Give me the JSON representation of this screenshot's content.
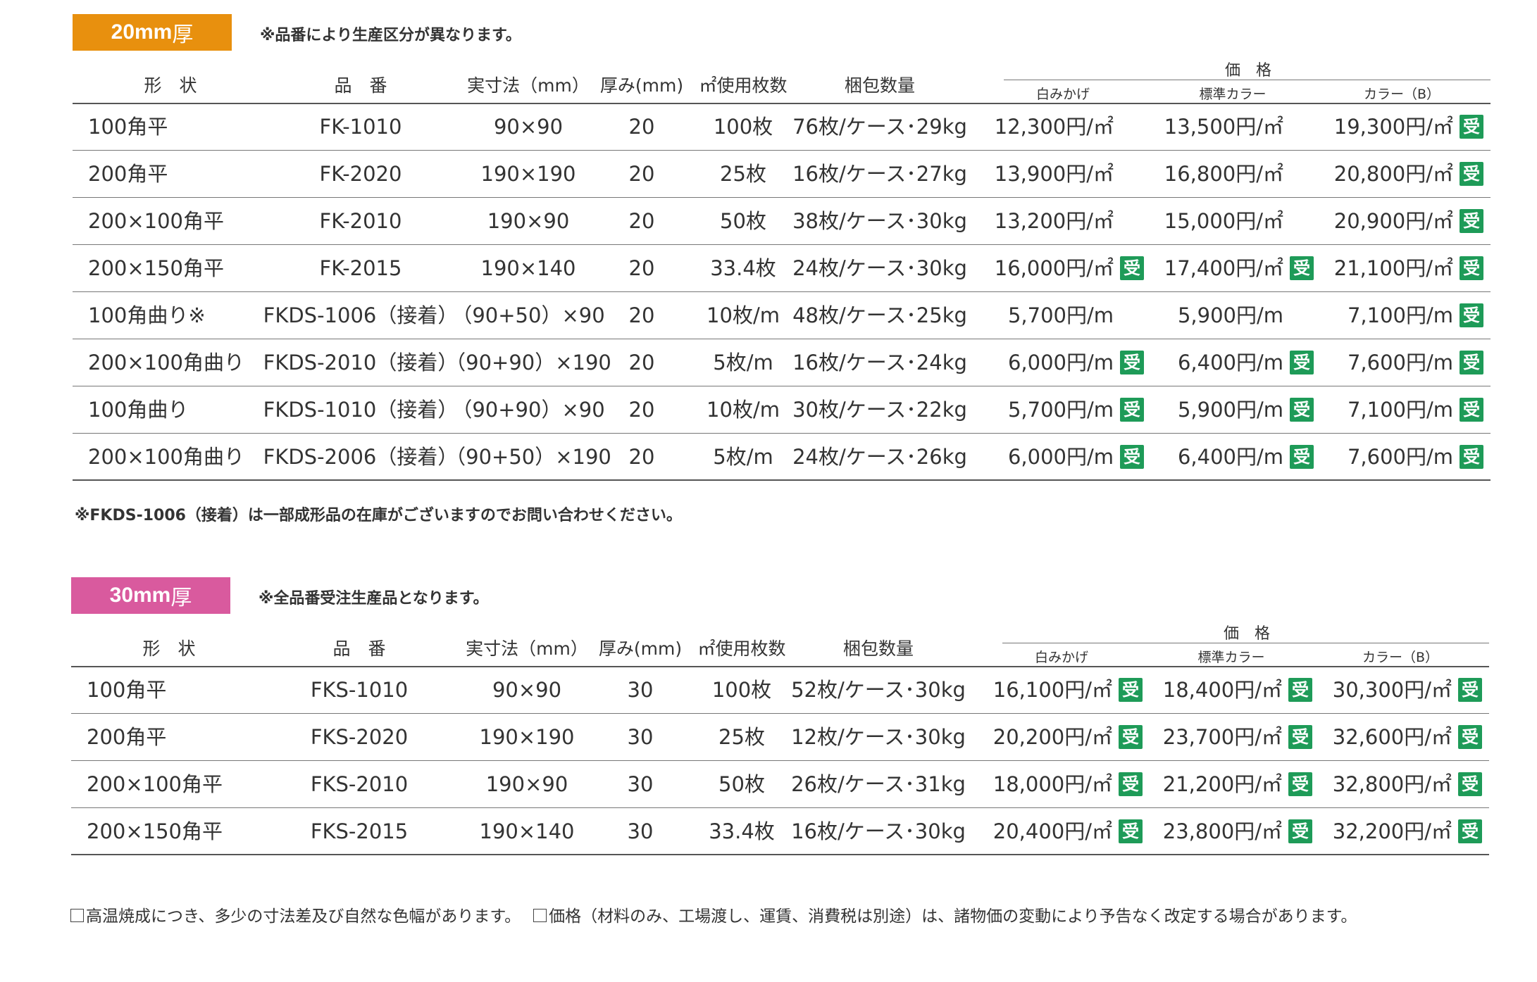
{
  "colors": {
    "orange": "#e8900e",
    "pink": "#d95a9e",
    "uke_green": "#1e9b58"
  },
  "headers": {
    "shape": "形　状",
    "code": "品　番",
    "size": "実寸法（mm）",
    "thickness": "厚み(mm)",
    "usage": "㎡使用枚数",
    "packing": "梱包数量",
    "price": "価　格",
    "white": "白みかげ",
    "standard": "標準カラー",
    "color_b": "カラー（B）"
  },
  "uke_label": "受",
  "section1": {
    "badge_number": "20mm",
    "badge_unit": "厚",
    "note": "※品番により生産区分が異なります。",
    "footnote": "※FKDS-1006（接着）は一部成形品の在庫がございますのでお問い合わせください。",
    "rows": [
      {
        "shape": "100角平",
        "code": "FK-1010",
        "size": "90×90",
        "thickness": "20",
        "usage": "100枚",
        "packing": "76枚/ケース･29kg",
        "p1": "12,300円/㎡",
        "p2": "13,500円/㎡",
        "p3": "19,300円/㎡",
        "u1": false,
        "u2": false,
        "u3": true
      },
      {
        "shape": "200角平",
        "code": "FK-2020",
        "size": "190×190",
        "thickness": "20",
        "usage": "25枚",
        "packing": "16枚/ケース･27kg",
        "p1": "13,900円/㎡",
        "p2": "16,800円/㎡",
        "p3": "20,800円/㎡",
        "u1": false,
        "u2": false,
        "u3": true
      },
      {
        "shape": "200×100角平",
        "code": "FK-2010",
        "size": "190×90",
        "thickness": "20",
        "usage": "50枚",
        "packing": "38枚/ケース･30kg",
        "p1": "13,200円/㎡",
        "p2": "15,000円/㎡",
        "p3": "20,900円/㎡",
        "u1": false,
        "u2": false,
        "u3": true
      },
      {
        "shape": "200×150角平",
        "code": "FK-2015",
        "size": "190×140",
        "thickness": "20",
        "usage": "33.4枚",
        "packing": "24枚/ケース･30kg",
        "p1": "16,000円/㎡",
        "p2": "17,400円/㎡",
        "p3": "21,100円/㎡",
        "u1": true,
        "u2": true,
        "u3": true
      },
      {
        "shape": "100角曲り※",
        "code": "FKDS-1006（接着）",
        "size": "（90+50）×90",
        "thickness": "20",
        "usage": "10枚/m",
        "packing": "48枚/ケース･25kg",
        "p1": "5,700円/m",
        "p2": "5,900円/m",
        "p3": "7,100円/m",
        "u1": false,
        "u2": false,
        "u3": true
      },
      {
        "shape": "200×100角曲り",
        "code": "FKDS-2010（接着）",
        "size": "（90+90）×190",
        "thickness": "20",
        "usage": "5枚/m",
        "packing": "16枚/ケース･24kg",
        "p1": "6,000円/m",
        "p2": "6,400円/m",
        "p3": "7,600円/m",
        "u1": true,
        "u2": true,
        "u3": true
      },
      {
        "shape": "100角曲り",
        "code": "FKDS-1010（接着）",
        "size": "（90+90）×90",
        "thickness": "20",
        "usage": "10枚/m",
        "packing": "30枚/ケース･22kg",
        "p1": "5,700円/m",
        "p2": "5,900円/m",
        "p3": "7,100円/m",
        "u1": true,
        "u2": true,
        "u3": true
      },
      {
        "shape": "200×100角曲り",
        "code": "FKDS-2006（接着）",
        "size": "（90+50）×190",
        "thickness": "20",
        "usage": "5枚/m",
        "packing": "24枚/ケース･26kg",
        "p1": "6,000円/m",
        "p2": "6,400円/m",
        "p3": "7,600円/m",
        "u1": true,
        "u2": true,
        "u3": true
      }
    ]
  },
  "section2": {
    "badge_number": "30mm",
    "badge_unit": "厚",
    "note": "※全品番受注生産品となります。",
    "rows": [
      {
        "shape": "100角平",
        "code": "FKS-1010",
        "size": "90×90",
        "thickness": "30",
        "usage": "100枚",
        "packing": "52枚/ケース･30kg",
        "p1": "16,100円/㎡",
        "p2": "18,400円/㎡",
        "p3": "30,300円/㎡",
        "u1": true,
        "u2": true,
        "u3": true
      },
      {
        "shape": "200角平",
        "code": "FKS-2020",
        "size": "190×190",
        "thickness": "30",
        "usage": "25枚",
        "packing": "12枚/ケース･30kg",
        "p1": "20,200円/㎡",
        "p2": "23,700円/㎡",
        "p3": "32,600円/㎡",
        "u1": true,
        "u2": true,
        "u3": true
      },
      {
        "shape": "200×100角平",
        "code": "FKS-2010",
        "size": "190×90",
        "thickness": "30",
        "usage": "50枚",
        "packing": "26枚/ケース･31kg",
        "p1": "18,000円/㎡",
        "p2": "21,200円/㎡",
        "p3": "32,800円/㎡",
        "u1": true,
        "u2": true,
        "u3": true
      },
      {
        "shape": "200×150角平",
        "code": "FKS-2015",
        "size": "190×140",
        "thickness": "30",
        "usage": "33.4枚",
        "packing": "16枚/ケース･30kg",
        "p1": "20,400円/㎡",
        "p2": "23,800円/㎡",
        "p3": "32,200円/㎡",
        "u1": true,
        "u2": true,
        "u3": true
      }
    ]
  },
  "footer": {
    "note1": "高温焼成につき、多少の寸法差及び自然な色幅があります。",
    "note2": "価格（材料のみ、工場渡し、運賃、消費税は別途）は、諸物価の変動により予告なく改定する場合があります。"
  }
}
